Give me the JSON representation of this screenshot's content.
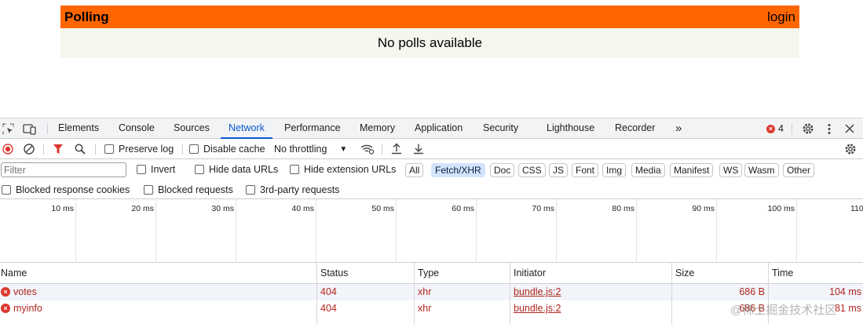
{
  "app": {
    "title": "Polling",
    "login": "login",
    "message": "No polls available",
    "header_color": "#ff6600"
  },
  "devtools": {
    "tabs": [
      "Elements",
      "Console",
      "Sources",
      "Network",
      "Performance",
      "Memory",
      "Application",
      "Security",
      "Lighthouse",
      "Recorder"
    ],
    "active_tab": "Network",
    "more_tabs_glyph": "»",
    "error_count": "4",
    "toolbar": {
      "preserve_log": "Preserve log",
      "disable_cache": "Disable cache",
      "throttling": "No throttling"
    },
    "filter": {
      "placeholder": "Filter",
      "invert": "Invert",
      "hide_data_urls": "Hide data URLs",
      "hide_extension_urls": "Hide extension URLs",
      "chips": [
        "All",
        "Fetch/XHR",
        "Doc",
        "CSS",
        "JS",
        "Font",
        "Img",
        "Media",
        "Manifest",
        "WS",
        "Wasm",
        "Other"
      ],
      "active_chip": "Fetch/XHR"
    },
    "filter2": {
      "blocked_cookies": "Blocked response cookies",
      "blocked_requests": "Blocked requests",
      "third_party": "3rd-party requests"
    },
    "timeline": {
      "ticks": [
        "10 ms",
        "20 ms",
        "30 ms",
        "40 ms",
        "50 ms",
        "60 ms",
        "70 ms",
        "80 ms",
        "90 ms",
        "100 ms",
        "110"
      ]
    },
    "table": {
      "headers": [
        "Name",
        "Status",
        "Type",
        "Initiator",
        "Size",
        "Time"
      ],
      "rows": [
        {
          "name": "votes",
          "status": "404",
          "type": "xhr",
          "initiator": "bundle.js:2",
          "size": "686 B",
          "time": "104 ms"
        },
        {
          "name": "myinfo",
          "status": "404",
          "type": "xhr",
          "initiator": "bundle.js:2",
          "size": "686 B",
          "time": "81 ms"
        }
      ]
    }
  },
  "watermark": "@稀土掘金技术社区"
}
